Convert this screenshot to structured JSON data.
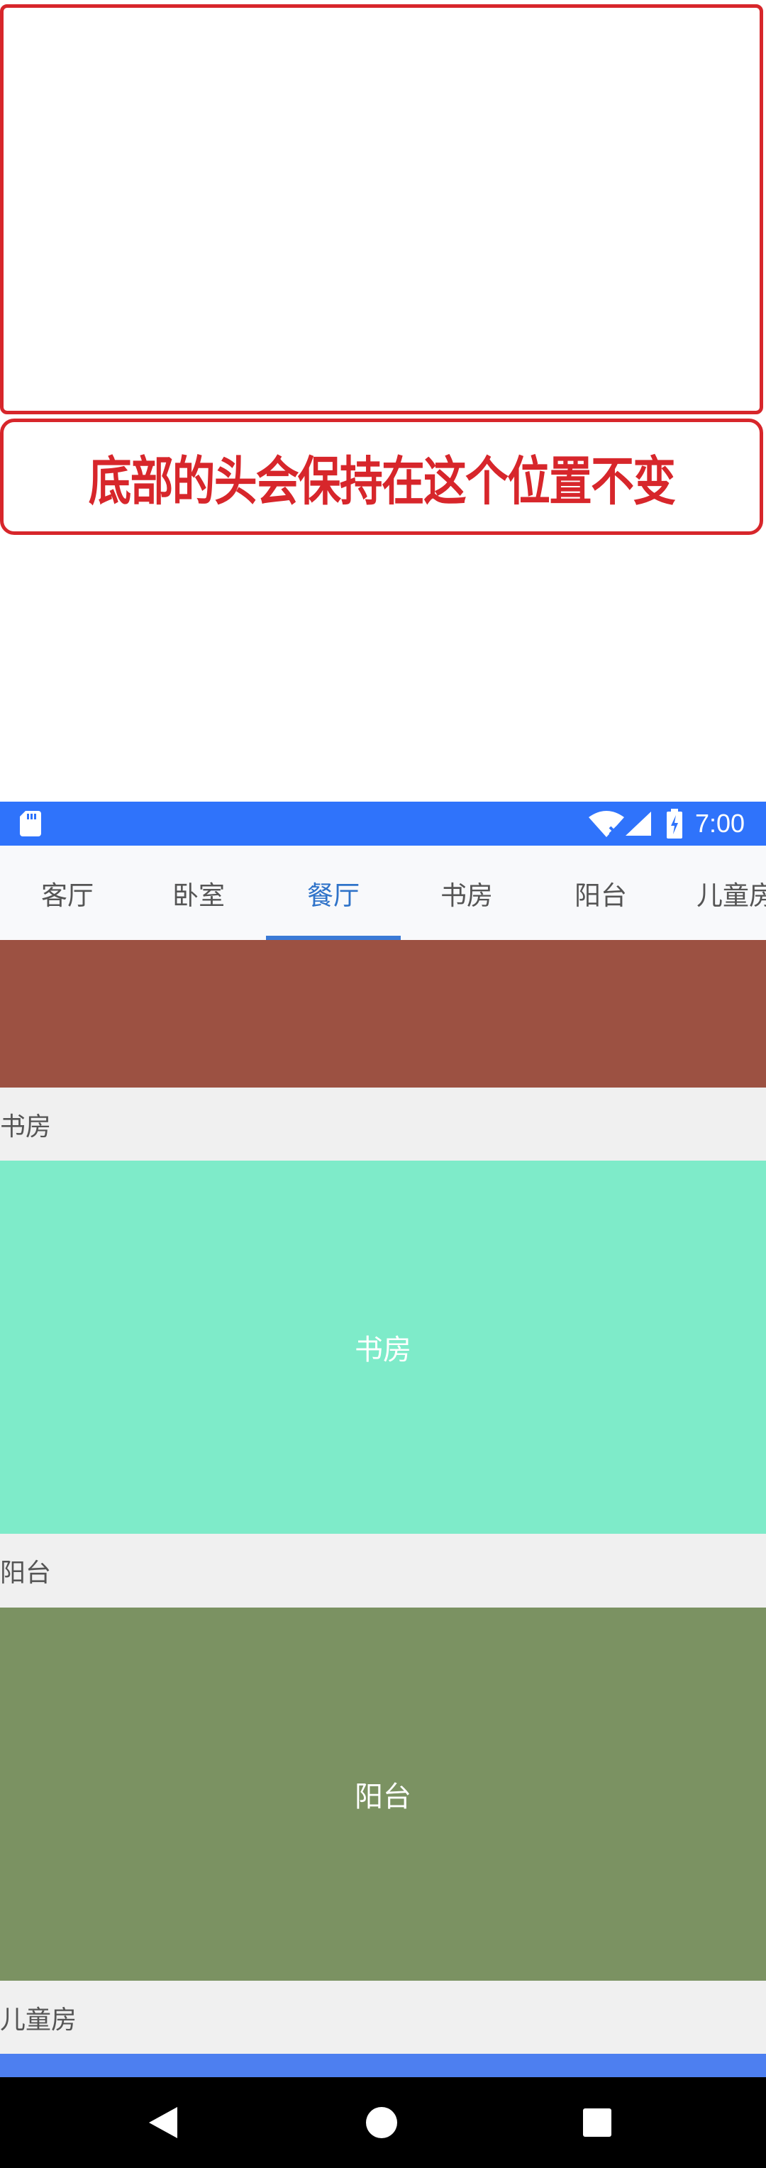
{
  "annotation": {
    "caption": "底部的头会保持在这个位置不变"
  },
  "status_bar": {
    "time": "7:00",
    "icons": [
      "sd-card-icon",
      "wifi-icon",
      "signal-icon",
      "battery-charging-icon"
    ],
    "color": "#2f73fb"
  },
  "tabs": {
    "items": [
      {
        "label": "客厅"
      },
      {
        "label": "卧室"
      },
      {
        "label": "餐厅"
      },
      {
        "label": "书房"
      },
      {
        "label": "阳台"
      },
      {
        "label": "儿童房"
      }
    ],
    "active_index": 2,
    "active_color": "#2f73c9"
  },
  "sections": [
    {
      "header": "书房",
      "block_label": "书房",
      "color": "#7eebc9"
    },
    {
      "header": "阳台",
      "block_label": "阳台",
      "color": "#7b9262"
    },
    {
      "header": "儿童房",
      "color": "#4d7ff0"
    }
  ],
  "top_block_color": "#9c5142",
  "nav_bar": {
    "icons": [
      "back-icon",
      "home-icon",
      "recents-icon"
    ]
  }
}
